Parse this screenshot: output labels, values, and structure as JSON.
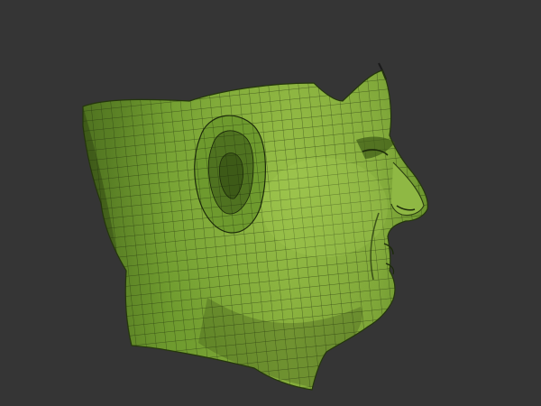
{
  "viewport": {
    "background": "#353535",
    "model": {
      "kind": "sculpted-head-mesh",
      "view": "side-profile",
      "facing": "right",
      "wireframe_visible": true,
      "colors": {
        "base": "#7aa236",
        "highlight": "#9cc24a",
        "shadow": "#4a6a1c",
        "wire": "#1c2a0a"
      }
    }
  }
}
